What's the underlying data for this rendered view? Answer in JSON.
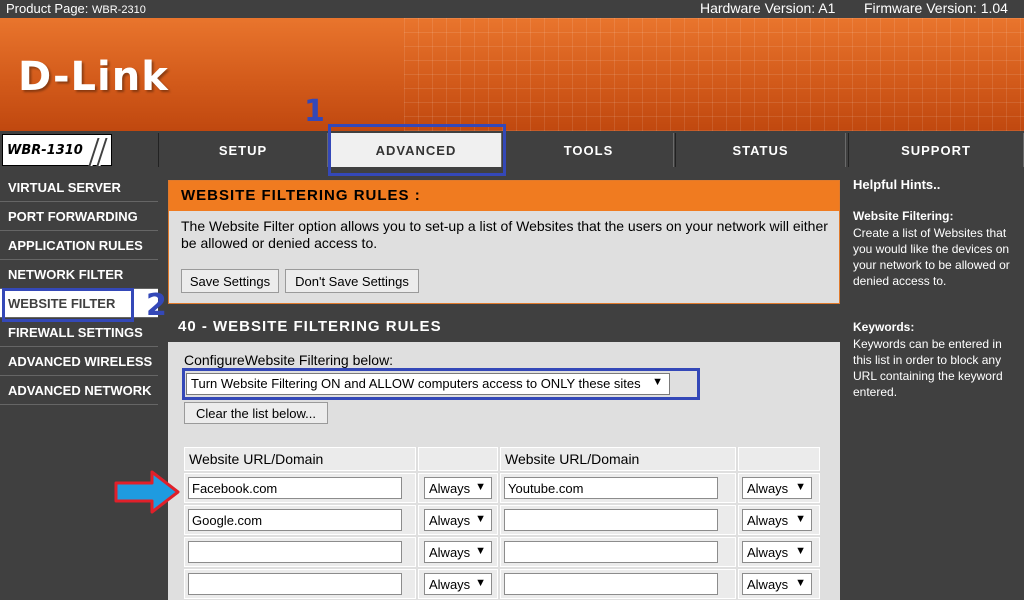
{
  "topbar": {
    "product_label": "Product Page:",
    "product_model": "WBR-2310",
    "hardware": "Hardware Version: A1",
    "firmware": "Firmware Version: 1.04"
  },
  "banner": {
    "logo": "D-Link"
  },
  "nav": {
    "model": "WBR-1310",
    "tabs": [
      {
        "label": "SETUP"
      },
      {
        "label": "ADVANCED"
      },
      {
        "label": "TOOLS"
      },
      {
        "label": "STATUS"
      },
      {
        "label": "SUPPORT"
      }
    ]
  },
  "sidebar": {
    "items": [
      {
        "label": "VIRTUAL SERVER"
      },
      {
        "label": "PORT FORWARDING"
      },
      {
        "label": "APPLICATION RULES"
      },
      {
        "label": "NETWORK FILTER"
      },
      {
        "label": "WEBSITE FILTER"
      },
      {
        "label": "FIREWALL SETTINGS"
      },
      {
        "label": "ADVANCED WIRELESS"
      },
      {
        "label": "ADVANCED NETWORK"
      }
    ]
  },
  "rules_box": {
    "title": "WEBSITE FILTERING RULES :",
    "description": "The Website Filter option allows you to set-up a list of Websites that the users on your network will either be allowed or denied access to.",
    "save_label": "Save Settings",
    "dont_save_label": "Don't Save Settings"
  },
  "list_box": {
    "title": "40 - WEBSITE FILTERING RULES",
    "configure_label": "ConfigureWebsite Filtering below:",
    "mode_value": "Turn Website Filtering ON and ALLOW computers access to ONLY these sites",
    "clear_label": "Clear the list below...",
    "col_header": "Website URL/Domain",
    "rows": [
      {
        "left_url": "Facebook.com",
        "left_sched": "Always",
        "right_url": "Youtube.com",
        "right_sched": "Always"
      },
      {
        "left_url": "Google.com",
        "left_sched": "Always",
        "right_url": "",
        "right_sched": "Always"
      },
      {
        "left_url": "",
        "left_sched": "Always",
        "right_url": "",
        "right_sched": "Always"
      },
      {
        "left_url": "",
        "left_sched": "Always",
        "right_url": "",
        "right_sched": "Always"
      }
    ]
  },
  "hints": {
    "title": "Helpful Hints..",
    "sec1_title": "Website Filtering:",
    "sec1_text": "Create a list of Websites that you would like the devices on your network to be allowed or denied access to.",
    "sec2_title": "Keywords:",
    "sec2_text": "Keywords can be entered in this list in order to block any URL containing the keyword entered."
  },
  "annotations": {
    "step1": "1",
    "step2": "2"
  },
  "colors": {
    "orange": "#f07b20",
    "dark": "#404040",
    "annotation_blue": "#3448b8",
    "arrow_blue": "#1e9be0",
    "arrow_red": "#e0202a"
  }
}
